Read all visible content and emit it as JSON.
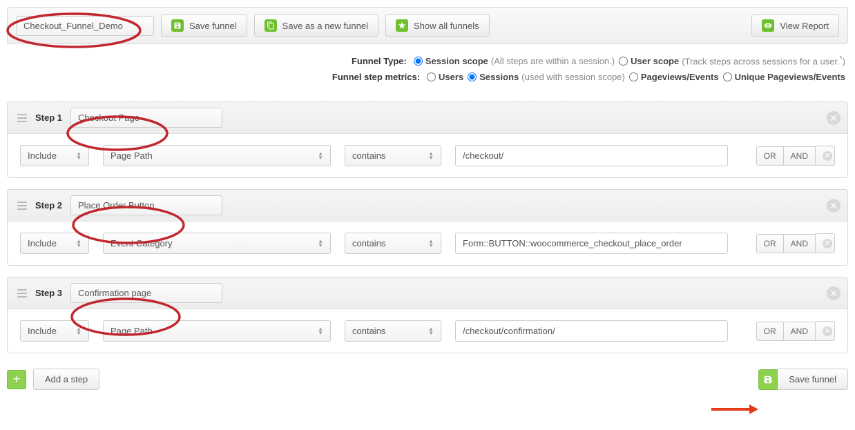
{
  "toolbar": {
    "funnel_name": "Checkout_Funnel_Demo",
    "save_label": "Save funnel",
    "save_as_label": "Save as a new funnel",
    "show_all_label": "Show all funnels",
    "view_report_label": "View Report"
  },
  "options": {
    "funnel_type_label": "Funnel Type:",
    "session_scope_label": "Session scope",
    "session_scope_hint": "(All steps are within a session.)",
    "user_scope_label": "User scope",
    "user_scope_hint": "(Track steps across sessions for a user.",
    "user_scope_sup": "*",
    "user_scope_hint_close": ")",
    "metrics_label": "Funnel step metrics:",
    "metric_users": "Users",
    "metric_sessions": "Sessions",
    "metric_sessions_hint": "(used with session scope)",
    "metric_pv": "Pageviews/Events",
    "metric_upv": "Unique Pageviews/Events",
    "funnel_type_selected": "session",
    "metric_selected": "sessions"
  },
  "common": {
    "include_label": "Include",
    "contains_label": "contains",
    "or_label": "OR",
    "and_label": "AND"
  },
  "steps": [
    {
      "prefix": "Step 1",
      "name": "Checkout Page",
      "dimension": "Page Path",
      "value": "/checkout/"
    },
    {
      "prefix": "Step 2",
      "name": "Place Order Button",
      "dimension": "Event Category",
      "value": "Form::BUTTON::woocommerce_checkout_place_order"
    },
    {
      "prefix": "Step 3",
      "name": "Confirmation page",
      "dimension": "Page Path",
      "value": "/checkout/confirmation/"
    }
  ],
  "footer": {
    "add_step_label": "Add a step",
    "save_label": "Save funnel"
  }
}
